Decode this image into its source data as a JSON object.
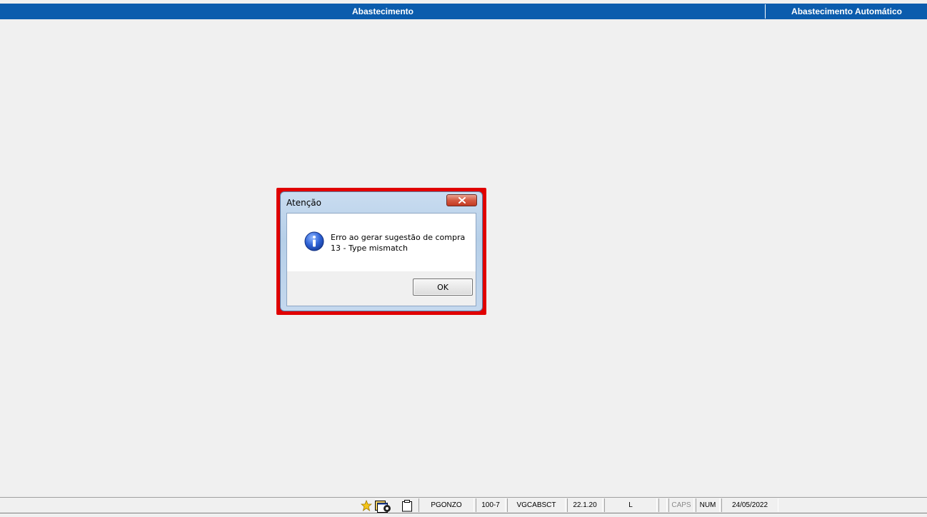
{
  "header": {
    "title": "Abastecimento",
    "right_title": "Abastecimento Automático"
  },
  "dialog": {
    "title": "Atenção",
    "message_line1": "Erro ao gerar sugestão de compra",
    "message_line2": "13 - Type mismatch",
    "ok_label": "OK",
    "icon": "info-icon",
    "highlight_color": "#e00000"
  },
  "statusbar": {
    "icons": [
      "star-icon",
      "window-settings-icon",
      "clipboard-icon"
    ],
    "user": "PGONZO",
    "code": "100-7",
    "module": "VGCABSCT",
    "version": "22.1.20",
    "mode": "L",
    "caps": "CAPS",
    "num": "NUM",
    "date": "24/05/2022"
  },
  "colors": {
    "header_bg": "#0b5cad",
    "background": "#f0f0f0"
  }
}
